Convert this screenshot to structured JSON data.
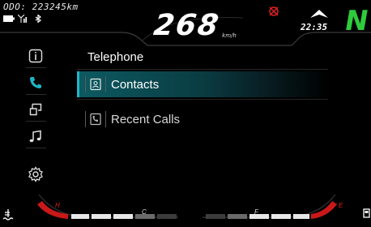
{
  "status": {
    "odometer": "ODO: 223245km",
    "speed": "268",
    "speed_unit": "km/h",
    "time": "22:35",
    "gear": "N"
  },
  "screen": {
    "title": "Telephone"
  },
  "menu": [
    {
      "label": "Contacts",
      "icon": "contact-card-icon",
      "active": true
    },
    {
      "label": "Recent Calls",
      "icon": "phone-log-icon",
      "active": false
    }
  ],
  "sidebar": [
    {
      "icon": "info-icon",
      "active": false
    },
    {
      "icon": "phone-icon",
      "active": true
    },
    {
      "icon": "screen-mirror-icon",
      "active": false
    },
    {
      "icon": "music-note-icon",
      "active": false
    },
    {
      "icon": "settings-gear-icon",
      "active": false
    }
  ],
  "gauges": {
    "temp_low_label": "C",
    "temp_high_label": "H",
    "fuel_low_label": "E",
    "fuel_high_label": "F"
  },
  "colors": {
    "accent": "#1fb6c4",
    "gear": "#2ecb3c",
    "warning": "#e02020"
  }
}
